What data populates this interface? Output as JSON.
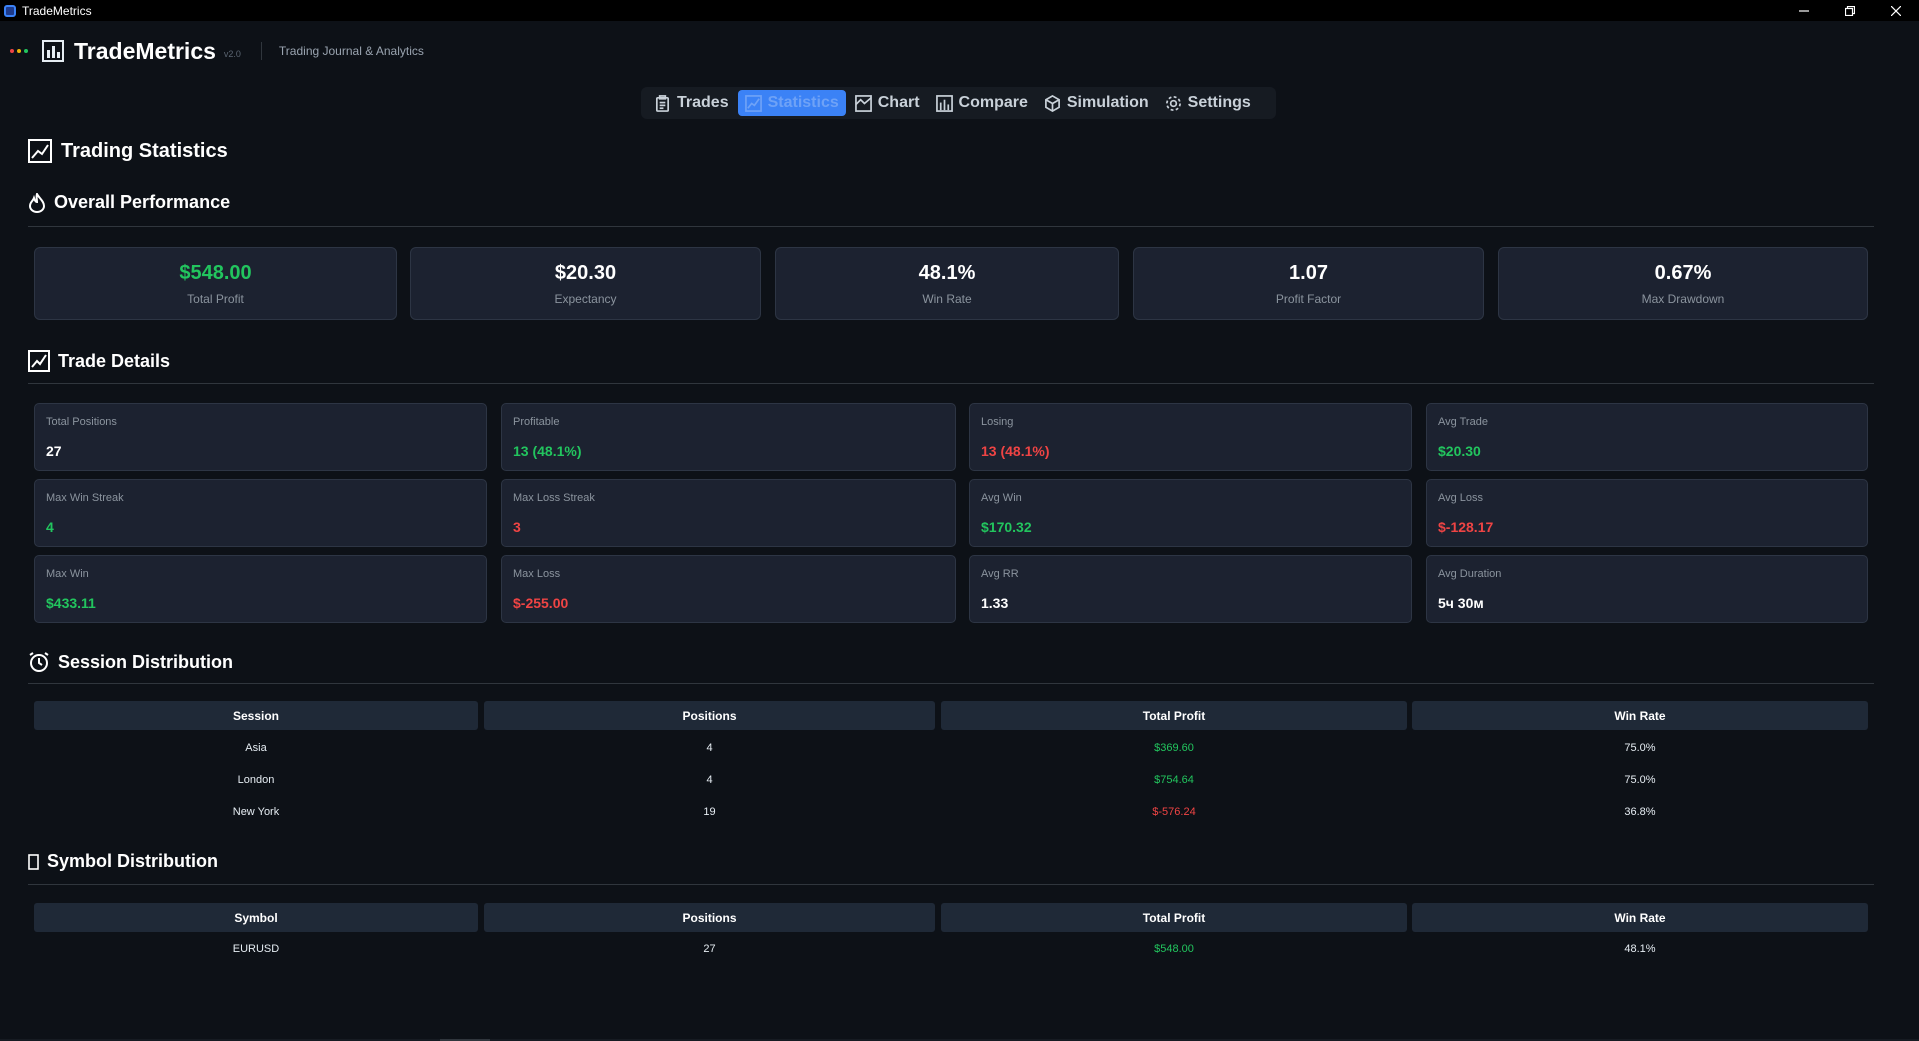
{
  "window": {
    "title": "TradeMetrics"
  },
  "header": {
    "brand": "TradeMetrics",
    "version": "v2.0",
    "subtitle": "Trading Journal & Analytics",
    "dot_colors": [
      "#ef4444",
      "#eab308",
      "#22c55e"
    ]
  },
  "tabs": [
    {
      "label": "Trades",
      "icon": "clipboard-icon",
      "active": false
    },
    {
      "label": "Statistics",
      "icon": "chart-line-icon",
      "active": true
    },
    {
      "label": "Chart",
      "icon": "chart-icon",
      "active": false
    },
    {
      "label": "Compare",
      "icon": "bar-chart-icon",
      "active": false
    },
    {
      "label": "Simulation",
      "icon": "cube-icon",
      "active": false
    },
    {
      "label": "Settings",
      "icon": "gear-icon",
      "active": false
    }
  ],
  "page_title": "Trading Statistics",
  "overall": {
    "heading": "Overall Performance",
    "cards": [
      {
        "value": "$548.00",
        "label": "Total Profit",
        "tone": "pos"
      },
      {
        "value": "$20.30",
        "label": "Expectancy",
        "tone": "neutral"
      },
      {
        "value": "48.1%",
        "label": "Win Rate",
        "tone": "neutral"
      },
      {
        "value": "1.07",
        "label": "Profit Factor",
        "tone": "neutral"
      },
      {
        "value": "0.67%",
        "label": "Max Drawdown",
        "tone": "neutral"
      }
    ]
  },
  "details": {
    "heading": "Trade Details",
    "cards": [
      {
        "label": "Total Positions",
        "value": "27",
        "tone": "neutral"
      },
      {
        "label": "Profitable",
        "value": "13 (48.1%)",
        "tone": "pos"
      },
      {
        "label": "Losing",
        "value": "13 (48.1%)",
        "tone": "neg"
      },
      {
        "label": "Avg Trade",
        "value": "$20.30",
        "tone": "pos"
      },
      {
        "label": "Max Win Streak",
        "value": "4",
        "tone": "pos"
      },
      {
        "label": "Max Loss Streak",
        "value": "3",
        "tone": "neg"
      },
      {
        "label": "Avg Win",
        "value": "$170.32",
        "tone": "pos"
      },
      {
        "label": "Avg Loss",
        "value": "$-128.17",
        "tone": "neg"
      },
      {
        "label": "Max Win",
        "value": "$433.11",
        "tone": "pos"
      },
      {
        "label": "Max Loss",
        "value": "$-255.00",
        "tone": "neg"
      },
      {
        "label": "Avg RR",
        "value": "1.33",
        "tone": "neutral"
      },
      {
        "label": "Avg Duration",
        "value": "5ч 30м",
        "tone": "neutral"
      }
    ]
  },
  "session": {
    "heading": "Session Distribution",
    "columns": [
      "Session",
      "Positions",
      "Total Profit",
      "Win Rate"
    ],
    "rows": [
      {
        "name": "Asia",
        "positions": "4",
        "profit": "$369.60",
        "tone": "pos",
        "win_rate": "75.0%"
      },
      {
        "name": "London",
        "positions": "4",
        "profit": "$754.64",
        "tone": "pos",
        "win_rate": "75.0%"
      },
      {
        "name": "New York",
        "positions": "19",
        "profit": "$-576.24",
        "tone": "neg",
        "win_rate": "36.8%"
      }
    ]
  },
  "symbol": {
    "heading": "Symbol Distribution",
    "columns": [
      "Symbol",
      "Positions",
      "Total Profit",
      "Win Rate"
    ],
    "rows": [
      {
        "name": "EURUSD",
        "positions": "27",
        "profit": "$548.00",
        "tone": "pos",
        "win_rate": "48.1%"
      }
    ]
  },
  "colors": {
    "accent": "#3b82f6",
    "positive": "#22c55e",
    "negative": "#ef4444",
    "background": "#0d1117",
    "card": "#1c2230"
  }
}
